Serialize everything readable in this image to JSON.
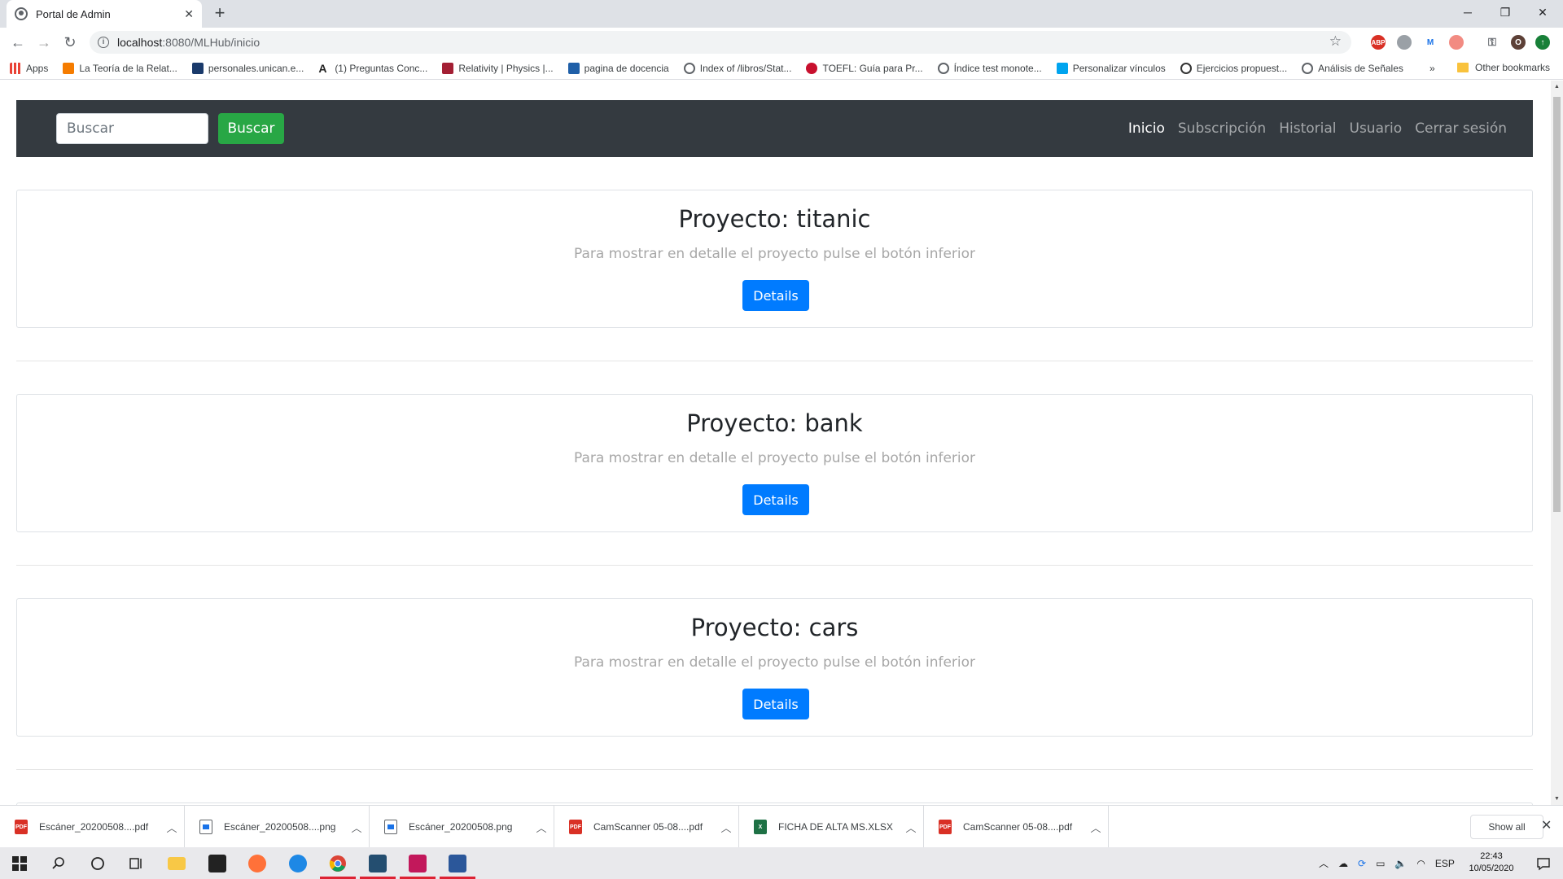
{
  "browser": {
    "tab_title": "Portal de Admin",
    "url_host": "localhost",
    "url_path": ":8080/MLHub/inicio",
    "bookmarks": [
      {
        "label": "Apps",
        "color": "#e94235"
      },
      {
        "label": "La Teoría de la Relat...",
        "color": "#f57c00"
      },
      {
        "label": "personales.unican.e...",
        "color": "#1a3a6b"
      },
      {
        "label": "(1) Preguntas Conc...",
        "color": "#222222"
      },
      {
        "label": "Relativity | Physics |...",
        "color": "#a31f34"
      },
      {
        "label": "pagina de docencia",
        "color": "#1f5fa8"
      },
      {
        "label": "Index of /libros/Stat...",
        "color": "#5f6368"
      },
      {
        "label": "TOEFL: Guía para Pr...",
        "color": "#c8102e"
      },
      {
        "label": "Índice test monote...",
        "color": "#5f6368"
      },
      {
        "label": "Personalizar vínculos",
        "color": "#00a4ef"
      },
      {
        "label": "Ejercicios propuest...",
        "color": "#333333"
      },
      {
        "label": "Análisis de Señales",
        "color": "#5f6368"
      }
    ],
    "bookmarks_more": "»",
    "other_bookmarks": "Other bookmarks"
  },
  "navbar": {
    "search_placeholder": "Buscar",
    "search_button": "Buscar",
    "links": [
      {
        "label": "Inicio",
        "active": true
      },
      {
        "label": "Subscripción",
        "active": false
      },
      {
        "label": "Historial",
        "active": false
      },
      {
        "label": "Usuario",
        "active": false
      },
      {
        "label": "Cerrar sesión",
        "active": false
      }
    ]
  },
  "projects": [
    {
      "title": "Proyecto: titanic",
      "subtitle": "Para mostrar en detalle el proyecto pulse el botón inferior",
      "button": "Details"
    },
    {
      "title": "Proyecto: bank",
      "subtitle": "Para mostrar en detalle el proyecto pulse el botón inferior",
      "button": "Details"
    },
    {
      "title": "Proyecto: cars",
      "subtitle": "Para mostrar en detalle el proyecto pulse el botón inferior",
      "button": "Details"
    }
  ],
  "downloads": {
    "items": [
      {
        "name": "Escáner_20200508....pdf",
        "type": "pdf-icon"
      },
      {
        "name": "Escáner_20200508....png",
        "type": "image-file-icon"
      },
      {
        "name": "Escáner_20200508.png",
        "type": "image-file-icon"
      },
      {
        "name": "CamScanner 05-08....pdf",
        "type": "pdf-icon"
      },
      {
        "name": "FICHA DE ALTA MS.XLSX",
        "type": "excel-icon"
      },
      {
        "name": "CamScanner 05-08....pdf",
        "type": "pdf-icon"
      }
    ],
    "show_all": "Show all"
  },
  "taskbar": {
    "language": "ESP",
    "time": "22:43",
    "date": "10/05/2020"
  },
  "colors": {
    "navbar_bg": "#343a40",
    "search_button": "#28a745",
    "details_button": "#007bff"
  }
}
